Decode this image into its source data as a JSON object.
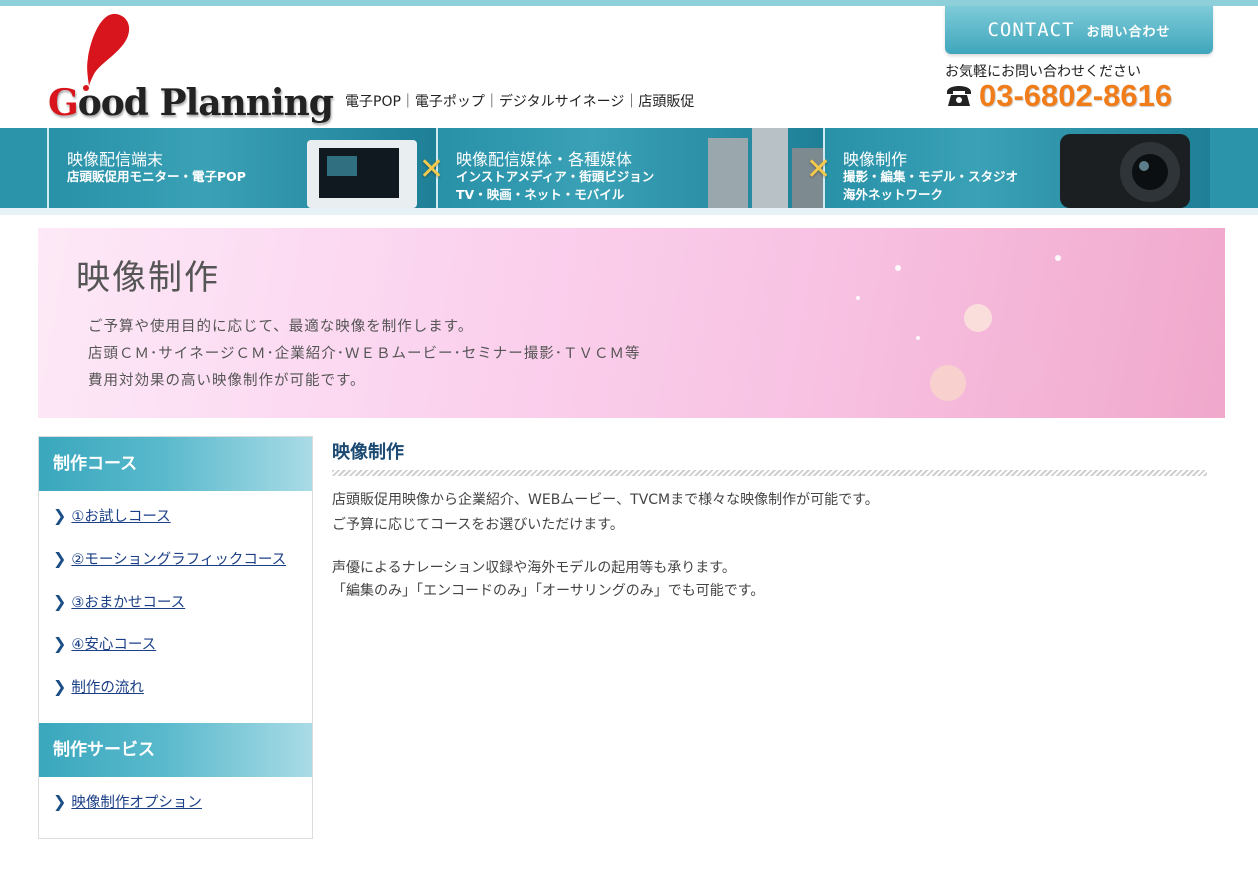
{
  "header": {
    "logo_text": "Good Planning",
    "tagline": "電子POP｜電子ポップ｜デジタルサイネージ｜店頭販促",
    "contact_en": "CONTACT",
    "contact_ja": "お問い合わせ",
    "phone_note": "お気軽にお問い合わせください",
    "phone_number": "03-6802-8616"
  },
  "nav": [
    {
      "title": "映像配信端末",
      "sub": "店頭販促用モニター・電子POP"
    },
    {
      "title": "映像配信媒体・各種媒体",
      "sub": "インストアメディア・街頭ビジョン",
      "sub2": "TV・映画・ネット・モバイル"
    },
    {
      "title": "映像制作",
      "sub": "撮影・編集・モデル・スタジオ",
      "sub2": "海外ネットワーク"
    }
  ],
  "nav_separator": "✕",
  "hero": {
    "title": "映像制作",
    "line1": "ご予算や使用目的に応じて、最適な映像を制作します。",
    "line2": "店頭ＣＭ･サイネージＣＭ･企業紹介･ＷＥＢムービー･セミナー撮影･ＴＶＣＭ等",
    "line3": "費用対効果の高い映像制作が可能です。"
  },
  "sidebar": {
    "course_heading": "制作コース",
    "courses": [
      "①お試しコース",
      "②モーショングラフィックコース",
      "③おまかせコース",
      "④安心コース",
      "制作の流れ"
    ],
    "service_heading": "制作サービス",
    "services": [
      "映像制作オプション"
    ]
  },
  "main": {
    "title": "映像制作",
    "p1_line1": "店頭販促用映像から企業紹介、WEBムービー、TVCMまで様々な映像制作が可能です。",
    "p1_line2": "ご予算に応じてコースをお選びいただけます。",
    "p2_line1": "声優によるナレーション収録や海外モデルの起用等も承ります。",
    "p2_line2": "「編集のみ」「エンコードのみ」「オーサリングのみ」でも可能です。"
  },
  "colors": {
    "accent": "#2b94ab",
    "phone": "#f07c1a",
    "link": "#1b3f87",
    "logo_red": "#d8141c"
  }
}
